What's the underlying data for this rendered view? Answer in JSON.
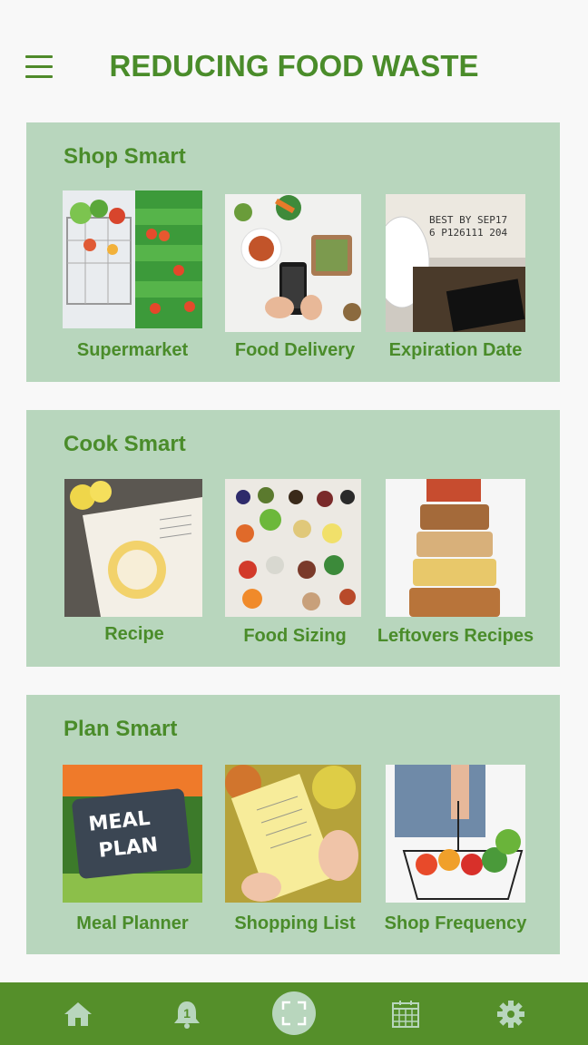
{
  "header": {
    "title": "REDUCING FOOD WASTE"
  },
  "sections": [
    {
      "title": "Shop Smart",
      "tiles": [
        {
          "label": "Supermarket"
        },
        {
          "label": "Food Delivery"
        },
        {
          "label": "Expiration Date"
        }
      ]
    },
    {
      "title": "Cook Smart",
      "tiles": [
        {
          "label": "Recipe"
        },
        {
          "label": "Food Sizing"
        },
        {
          "label": "Leftovers Recipes"
        }
      ]
    },
    {
      "title": "Plan Smart",
      "tiles": [
        {
          "label": "Meal Planner"
        },
        {
          "label": "Shopping List"
        },
        {
          "label": "Shop Frequency"
        }
      ]
    }
  ],
  "images": {
    "expiration_text_1": "BEST BY  SEP17",
    "expiration_text_2": "6 P126111   204",
    "meal_plan_sign": "MEAL PLAN"
  },
  "nav": {
    "items": [
      {
        "icon": "home-icon"
      },
      {
        "icon": "bell-icon",
        "badge": "1"
      },
      {
        "icon": "scan-icon"
      },
      {
        "icon": "calendar-icon"
      },
      {
        "icon": "gear-icon"
      }
    ]
  },
  "colors": {
    "primary_green": "#4a8c2a",
    "section_bg": "#b8d6bd",
    "nav_bg": "#558f2a",
    "page_bg": "#f8f8f8"
  }
}
